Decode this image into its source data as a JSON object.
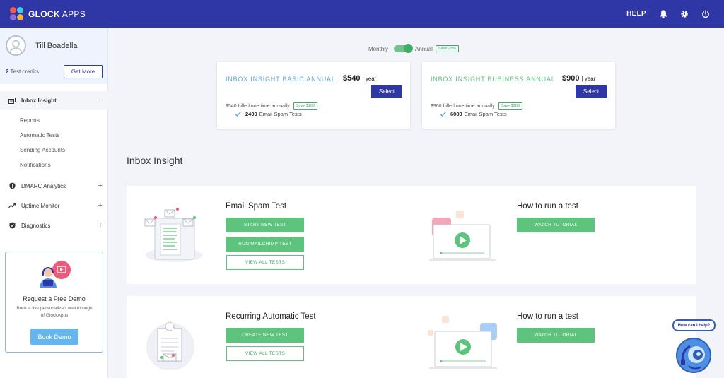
{
  "topbar": {
    "logo_bold": "GLOCK",
    "logo_rest": " APPS",
    "help_label": "HELP",
    "icons": [
      "bell-icon",
      "gear-icon",
      "power-icon"
    ]
  },
  "sidebar": {
    "user_name": "Till Boadella",
    "credits_count": "2",
    "credits_label": " Test credits",
    "get_more_label": "Get More",
    "sections": [
      {
        "label": "Inbox Insight",
        "icon": "inbox-icon",
        "toggle": "−"
      },
      {
        "label": "DMARC Analytics",
        "icon": "shield-icon",
        "toggle": "+"
      },
      {
        "label": "Uptime Monitor",
        "icon": "trend-icon",
        "toggle": "+"
      },
      {
        "label": "Diagnostics",
        "icon": "checkshield-icon",
        "toggle": "+"
      }
    ],
    "inbox_items": [
      "Reports",
      "Automatic Tests",
      "Sending Accounts",
      "Notifications"
    ],
    "demo": {
      "title": "Request a Free Demo",
      "description": "Book a live personalized walkthrough of GlockApps",
      "button_label": "Book Demo"
    }
  },
  "billing": {
    "monthly_label": "Monthly",
    "annual_label": "Annual",
    "annual_badge": "Save 25%"
  },
  "plans": [
    {
      "name": "INBOX INSIGHT BASIC ANNUAL",
      "price": "$540",
      "period": "| year",
      "select_label": "Select",
      "billed": "$540 billed one time annually",
      "save_badge": "Save $168",
      "tests_count": "2400",
      "tests_label": "Email Spam Tests",
      "name_color": "#5ba7dc"
    },
    {
      "name": "INBOX INSIGHT BUSINESS ANNUAL",
      "price": "$900",
      "period": "| year",
      "select_label": "Select",
      "billed": "$900 billed one time annually",
      "save_badge": "Save $288",
      "tests_count": "6000",
      "tests_label": "Email Spam Tests",
      "name_color": "#5ec37c"
    }
  ],
  "main": {
    "section_title": "Inbox Insight",
    "panels": [
      {
        "heading": "Email Spam Test",
        "buttons": [
          "START NEW TEST",
          "RUN MAILCHIMP TEST"
        ],
        "outline_button": "VIEW ALL TESTS",
        "tutorial_heading": "How to run a test",
        "tutorial_button": "WATCH TUTORIAL"
      },
      {
        "heading": "Recurring Automatic Test",
        "buttons": [
          "CREATE NEW TEST"
        ],
        "outline_button": "VIEW ALL TESTS",
        "tutorial_heading": "How to run a test",
        "tutorial_button": "WATCH TUTORIAL"
      }
    ]
  },
  "chat": {
    "bubble_label": "How can I help?"
  },
  "colors": {
    "brand": "#2f36a6",
    "accent_green": "#5ec37c",
    "accent_blue": "#67b5ee"
  }
}
